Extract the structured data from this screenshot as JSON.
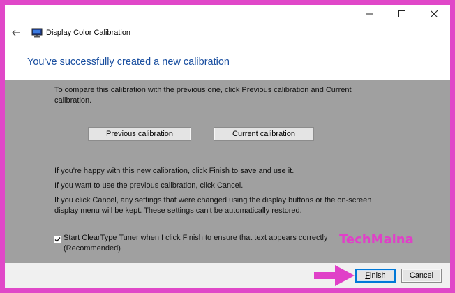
{
  "window": {
    "title": "Display Color Calibration",
    "icons": {
      "minimize": "minimize-icon",
      "maximize": "maximize-icon",
      "close": "close-icon",
      "back": "back-arrow-icon",
      "app": "monitor-icon"
    }
  },
  "page": {
    "heading": "You've successfully created a new calibration",
    "compare_text": "To compare this calibration with the previous one, click Previous calibration and Current calibration.",
    "previous_button": {
      "accel": "P",
      "rest": "revious calibration"
    },
    "current_button": {
      "accel": "C",
      "rest": "urrent calibration"
    },
    "happy_text": "If you're happy with this new calibration, click Finish to save and use it.",
    "previous_text": "If you want to use the previous calibration, click Cancel.",
    "cancel_text": "If you click Cancel, any settings that were changed using the display buttons or the on-screen display menu will be kept. These settings can't be automatically restored.",
    "cleartype": {
      "checked": true,
      "accel": "S",
      "rest": "tart ClearType Tuner when I click Finish to ensure that text appears correctly (Recommended)"
    }
  },
  "footer": {
    "finish": {
      "accel": "F",
      "rest": "inish"
    },
    "cancel_label": "Cancel"
  },
  "watermark": "TechMaina",
  "colors": {
    "frame": "#e048c8",
    "content_bg": "#a0a0a0",
    "heading": "#1a4fa0",
    "watermark": "#e040c8",
    "accent_border": "#0078d7"
  }
}
